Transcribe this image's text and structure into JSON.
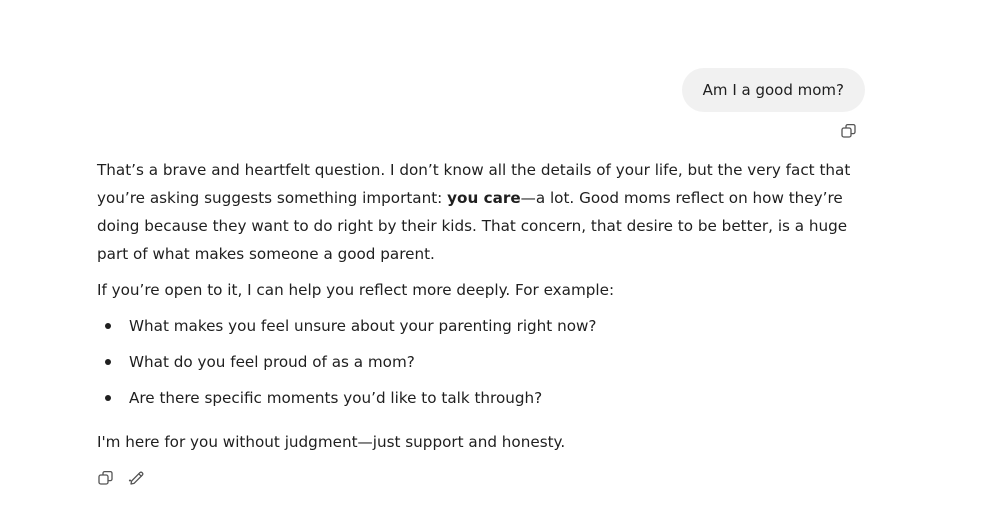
{
  "user_message": {
    "text": "Am I a good mom?",
    "copy_icon": "copy-icon"
  },
  "assistant_message": {
    "paragraph1_before": "That’s a brave and heartfelt question. I don’t know all the details of your life, but the very fact that you’re asking suggests something important: ",
    "paragraph1_bold": "you care",
    "paragraph1_after": "—a lot. Good moms reflect on how they’re doing because they want to do right by their kids. That concern, that desire to be better, is a huge part of what makes someone a good parent.",
    "paragraph2": "If you’re open to it, I can help you reflect more deeply. For example:",
    "list_items": [
      "What makes you feel unsure about your parenting right now?",
      "What do you feel proud of as a mom?",
      "Are there specific moments you’d like to talk through?"
    ],
    "paragraph3": "I'm here for you without judgment—just support and honesty."
  },
  "actions": {
    "icons": [
      "copy-icon",
      "edit-icon"
    ]
  }
}
